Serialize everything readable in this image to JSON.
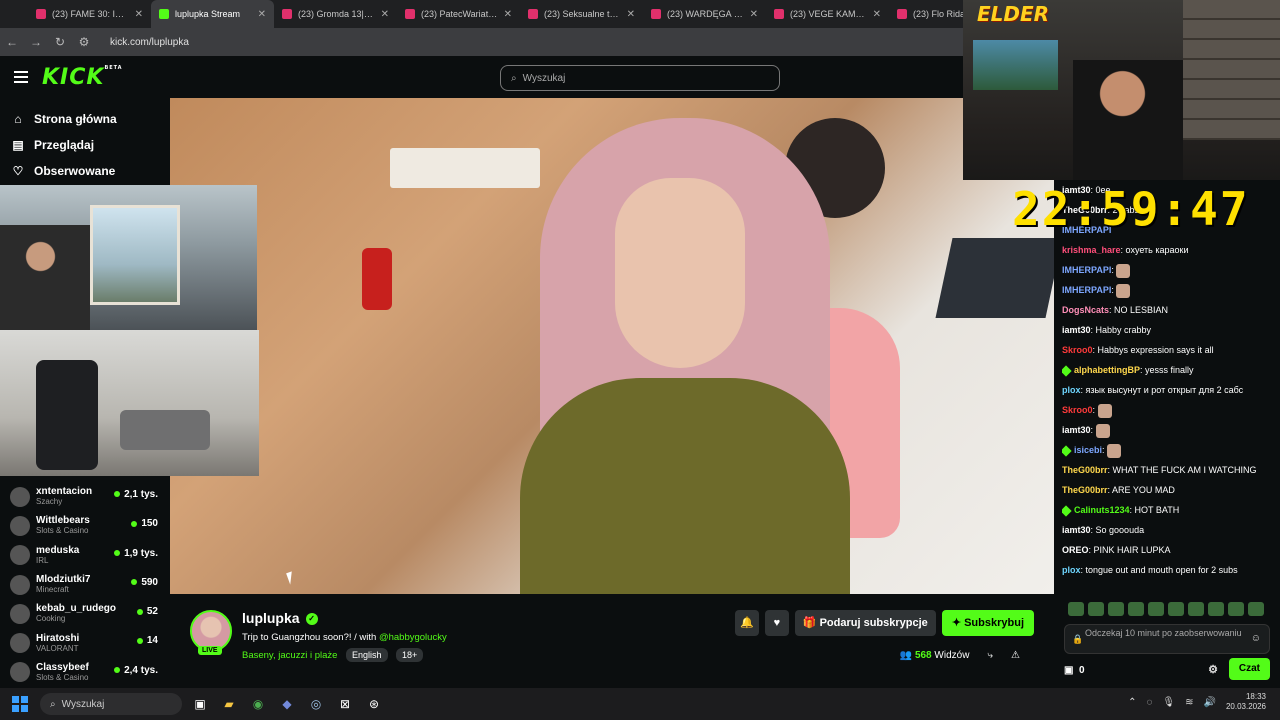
{
  "browser": {
    "tabs": [
      {
        "title": "(23) FAME 30: IRL+ Cl...",
        "active": false
      },
      {
        "title": "luplupka Stream",
        "active": true
      },
      {
        "title": "(23) Gromda 13| Dom",
        "active": false
      },
      {
        "title": "(23) PatecWariatec - Y",
        "active": false
      },
      {
        "title": "(23) Seksualne trójkąt",
        "active": false
      },
      {
        "title": "(23) WARDĘGA ZARZ",
        "active": false
      },
      {
        "title": "(23) VEGE KAMPANIA",
        "active": false
      },
      {
        "title": "(23) Flo Rida - I",
        "active": false
      }
    ],
    "url": "kick.com/luplupka"
  },
  "header": {
    "logo": "KICK",
    "logo_badge": "BETA",
    "search_placeholder": "Wyszukaj"
  },
  "nav": [
    {
      "icon": "home-icon",
      "label": "Strona główna"
    },
    {
      "icon": "browse-icon",
      "label": "Przeglądaj"
    },
    {
      "icon": "heart-icon",
      "label": "Obserwowane"
    }
  ],
  "channels": [
    {
      "name": "xntentacion",
      "category": "Szachy",
      "viewers": "2,1 tys."
    },
    {
      "name": "Wittlebears",
      "category": "Slots & Casino",
      "viewers": "150"
    },
    {
      "name": "meduska",
      "category": "IRL",
      "viewers": "1,9 tys."
    },
    {
      "name": "Mlodziutki7",
      "category": "Minecraft",
      "viewers": "590"
    },
    {
      "name": "kebab_u_rudego",
      "category": "Cooking",
      "viewers": "52"
    },
    {
      "name": "Hiratoshi",
      "category": "VALORANT",
      "viewers": "14"
    },
    {
      "name": "Classybeef",
      "category": "Slots & Casino",
      "viewers": "2,4 tys."
    }
  ],
  "overlay": {
    "brand": "ELDER",
    "timer": "22:59:47"
  },
  "chat": {
    "messages": [
      {
        "user": "iamt30",
        "color": "#ffffff",
        "text": ": 0ee...",
        "prefix": false
      },
      {
        "user": "TheG00brr",
        "color": "#ffffff",
        "text": ": 2 cabs...",
        "prefix": false
      },
      {
        "user": "IMHERPAPI",
        "color": "#7da7ff",
        "text": " ",
        "prefix": false
      },
      {
        "user": "krishma_hare",
        "color": "#ff4f7b",
        "text": ": охуеть караоки",
        "prefix": false
      },
      {
        "user": "IMHERPAPI",
        "color": "#7da7ff",
        "text": ":",
        "emote": true,
        "prefix": false
      },
      {
        "user": "IMHERPAPI",
        "color": "#7da7ff",
        "text": ":",
        "emote": true,
        "prefix": false
      },
      {
        "user": "DogsNcats",
        "color": "#ff8fb8",
        "text": ": NO LESBIAN",
        "prefix": false
      },
      {
        "user": "iamt30",
        "color": "#ffffff",
        "text": ": Habby crabby",
        "prefix": false
      },
      {
        "user": "Skroo0",
        "color": "#ff3b3b",
        "text": ": Habbys expression says it all",
        "prefix": false
      },
      {
        "user": "alphabettingBP",
        "color": "#ffd84d",
        "text": ": yesss finally",
        "prefix": true
      },
      {
        "user": "plox",
        "color": "#6fd6ff",
        "text": ": язык высунут и рот открыт для 2 сабс",
        "prefix": false
      },
      {
        "user": "Skroo0",
        "color": "#ff3b3b",
        "text": ":",
        "emote": true,
        "prefix": false
      },
      {
        "user": "iamt30",
        "color": "#ffffff",
        "text": ":",
        "emote": true,
        "prefix": false
      },
      {
        "user": "isicebi",
        "color": "#7da7ff",
        "text": ":",
        "emote": true,
        "prefix": true
      },
      {
        "user": "TheG00brr",
        "color": "#ffd84d",
        "text": ": WHAT THE FUCK AM I WATCHING",
        "prefix": false
      },
      {
        "user": "TheG00brr",
        "color": "#ffd84d",
        "text": ": ARE YOU MAD",
        "prefix": false
      },
      {
        "user": "Calinuts1234",
        "color": "#53fc18",
        "text": ": HOT BATH",
        "prefix": true
      },
      {
        "user": "iamt30",
        "color": "#ffffff",
        "text": ": So gooouda",
        "prefix": false
      },
      {
        "user": "OREO",
        "color": "#ffffff",
        "text": ": PINK HAIR LUPKA",
        "prefix": false
      },
      {
        "user": "plox",
        "color": "#6fd6ff",
        "text": ": tongue out and mouth open for 2 subs",
        "prefix": false
      }
    ],
    "input_placeholder": "Odczekaj 10 minut po zaobserwowaniu",
    "points": "0",
    "send_label": "Czat"
  },
  "stream": {
    "name": "luplupka",
    "live_label": "LIVE",
    "title": "Trip to Guangzhou soon?! / with ",
    "mention": "@habbygolucky",
    "category": "Baseny, jacuzzi i plaże",
    "tags": [
      "English",
      "18+"
    ],
    "gift_label": "Podaruj subskrypcje",
    "subscribe_label": "Subskrybuj",
    "viewers": "568",
    "viewers_label": "Widzów"
  },
  "taskbar": {
    "search": "Wyszukaj",
    "time": "18:33",
    "date": "20.03.2026"
  }
}
